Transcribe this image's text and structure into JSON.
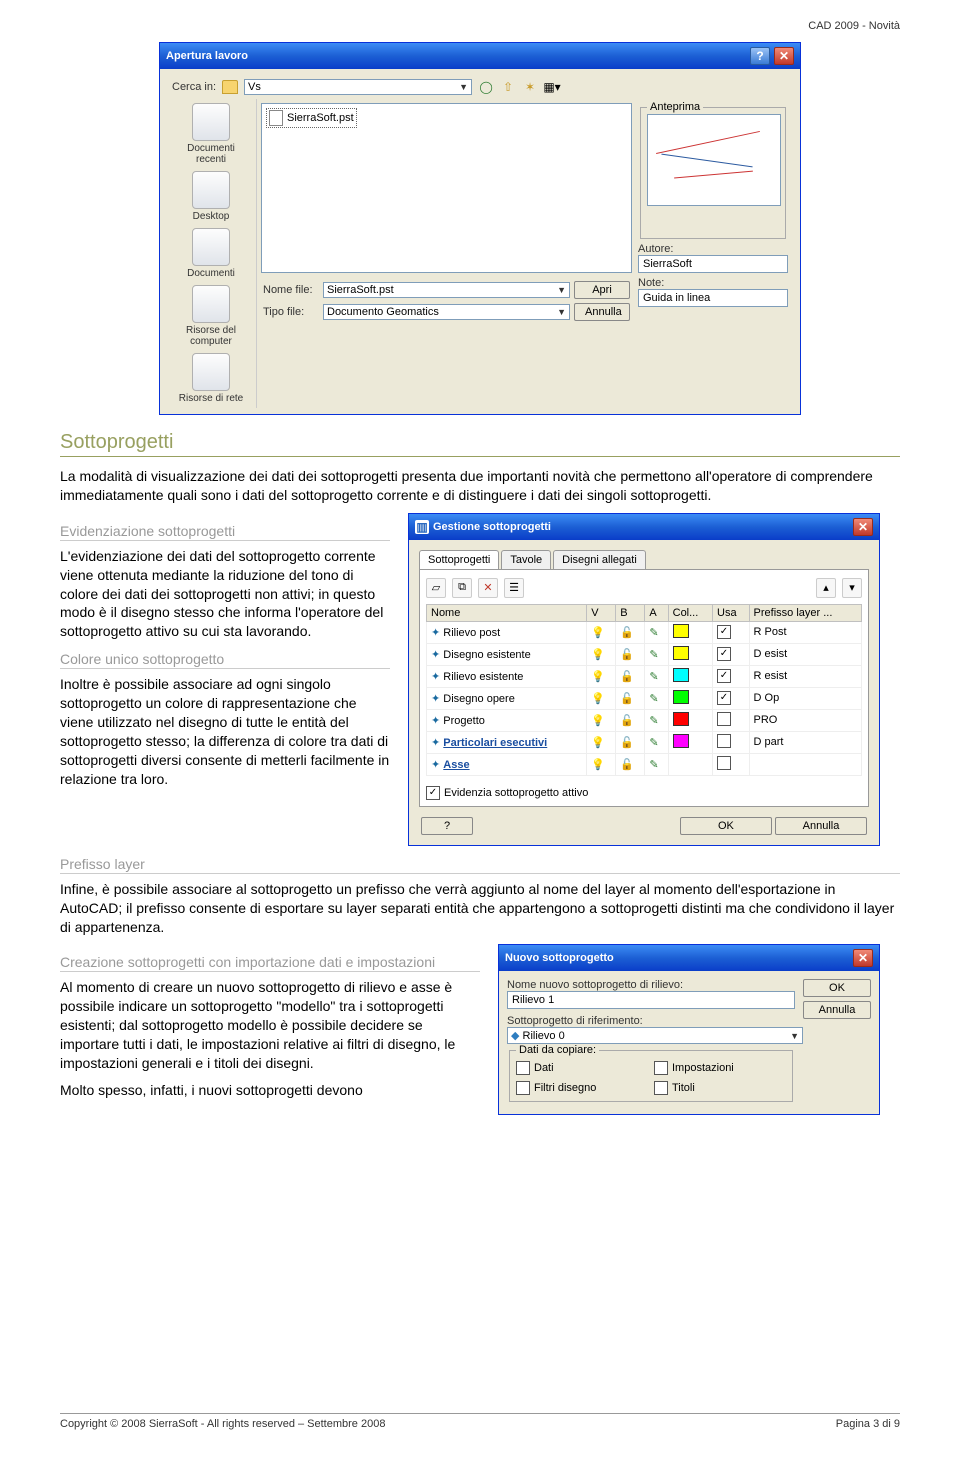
{
  "header": {
    "right": "CAD 2009 - Novità"
  },
  "footer": {
    "left": "Copyright © 2008 SierraSoft - All rights reserved – Settembre 2008",
    "right": "Pagina 3 di 9"
  },
  "file_dialog": {
    "title": "Apertura lavoro",
    "search_label": "Cerca in:",
    "search_value": "Vs",
    "sidebar": [
      "Documenti recenti",
      "Desktop",
      "Documenti",
      "Risorse del computer",
      "Risorse di rete"
    ],
    "file_row": "SierraSoft.pst",
    "name_label": "Nome file:",
    "name_value": "SierraSoft.pst",
    "type_label": "Tipo file:",
    "type_value": "Documento Geomatics",
    "open_btn": "Apri",
    "cancel_btn": "Annulla",
    "preview_label": "Anteprima",
    "author_label": "Autore:",
    "author_value": "SierraSoft",
    "note_label": "Note:",
    "note_value": "Guida in linea"
  },
  "section": {
    "title": "Sottoprogetti",
    "intro": "La modalità di visualizzazione dei dati dei sottoprogetti presenta due importanti novità che permettono all'operatore di comprendere immediatamente quali sono i dati del sottoprogetto corrente e di distinguere i dati dei singoli sottoprogetti.",
    "sub1_title": "Evidenziazione sottoprogetti",
    "sub1_text": "L'evidenziazione dei dati del sottoprogetto corrente viene ottenuta mediante la riduzione del tono di colore dei dati dei sottoprogetti non attivi; in questo modo è il disegno stesso che informa l'operatore del sottoprogetto attivo su cui sta lavorando.",
    "sub2_title": "Colore unico sottoprogetto",
    "sub2_text": "Inoltre è possibile associare ad ogni singolo sottoprogetto un colore di rappresentazione che viene utilizzato nel disegno di tutte le entità del sottoprogetto stesso; la differenza di colore tra dati di sottoprogetti diversi consente di metterli facilmente in relazione tra loro.",
    "sub3_title": "Prefisso layer",
    "sub3_text": "Infine, è possibile associare al sottoprogetto un prefisso che verrà aggiunto al nome del layer al momento dell'esportazione in AutoCAD; il prefisso consente di esportare su layer separati entità che appartengono a sottoprogetti distinti ma che condividono il layer di appartenenza.",
    "sub4_title": "Creazione sottoprogetti con importazione dati e impostazioni",
    "sub4_text1": "Al momento di creare un nuovo sottoprogetto di rilievo e asse è possibile indicare un sottoprogetto \"modello\" tra i sottoprogetti esistenti; dal sottoprogetto modello è possibile decidere se importare tutti i dati, le impostazioni relative ai filtri di disegno, le impostazioni generali e i titoli dei disegni.",
    "sub4_text2": "Molto spesso, infatti, i nuovi sottoprogetti devono"
  },
  "gsp": {
    "title": "Gestione sottoprogetti",
    "tabs": [
      "Sottoprogetti",
      "Tavole",
      "Disegni allegati"
    ],
    "headers": [
      "Nome",
      "V",
      "B",
      "A",
      "Col...",
      "Usa",
      "Prefisso layer ..."
    ],
    "rows": [
      {
        "name": "Rilievo post",
        "color": "#ffff00",
        "usa": true,
        "prefix": "R Post"
      },
      {
        "name": "Disegno esistente",
        "color": "#ffff00",
        "usa": true,
        "prefix": "D esist"
      },
      {
        "name": "Rilievo esistente",
        "color": "#00ffff",
        "usa": true,
        "prefix": "R esist"
      },
      {
        "name": "Disegno opere",
        "color": "#00ff00",
        "usa": true,
        "prefix": "D Op"
      },
      {
        "name": "Progetto",
        "color": "#ff0000",
        "usa": false,
        "prefix": "PRO"
      },
      {
        "name": "Particolari esecutivi",
        "color": "#ff00ff",
        "usa": false,
        "prefix": "D part"
      },
      {
        "name": "Asse",
        "color": "",
        "usa": false,
        "prefix": ""
      }
    ],
    "checkbox": "Evidenzia sottoprogetto attivo",
    "help": "?",
    "ok": "OK",
    "cancel": "Annulla"
  },
  "nsp": {
    "title": "Nuovo sottoprogetto",
    "name_label": "Nome nuovo sottoprogetto di rilievo:",
    "name_value": "Rilievo 1",
    "ref_label": "Sottoprogetto di riferimento:",
    "ref_value": "Rilievo 0",
    "group_label": "Dati da copiare:",
    "opts": [
      "Dati",
      "Impostazioni",
      "Filtri disegno",
      "Titoli"
    ],
    "ok": "OK",
    "cancel": "Annulla"
  }
}
